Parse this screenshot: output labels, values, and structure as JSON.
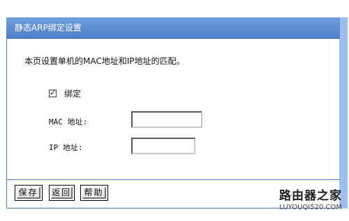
{
  "window": {
    "title": "静态ARP绑定设置"
  },
  "form": {
    "description": "本页设置单机的MAC地址和IP地址的匹配。",
    "bind_checkbox": {
      "label": "绑定",
      "checked": true
    },
    "mac_address": {
      "label": "MAC 地址:",
      "value": ""
    },
    "ip_address": {
      "label": "IP 地址:",
      "value": ""
    }
  },
  "buttons": {
    "save": "保存",
    "back": "返回",
    "help": "帮助"
  },
  "watermark": {
    "title": "路由器之家",
    "url": "LUYOUQI520.COM"
  },
  "colors": {
    "title_bar": "#4d7fc4",
    "side_rule": "#9ec0ee",
    "panel_border": "#4d7fc4"
  }
}
